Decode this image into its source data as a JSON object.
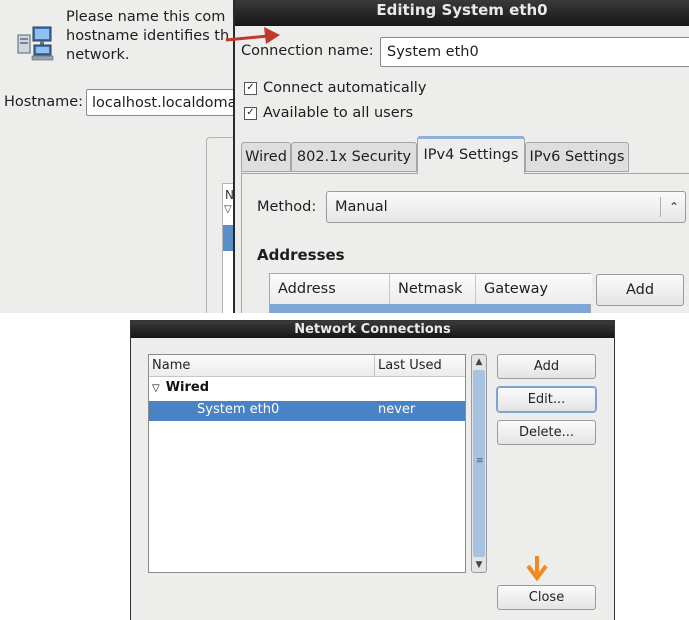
{
  "installer": {
    "message": "Please name this com\nhostname identifies th\nnetwork.",
    "hostname_label": "Hostname:",
    "hostname_value": "localhost.localdomai"
  },
  "edit_dialog": {
    "title": "Editing System eth0",
    "connection_name_label": "Connection name:",
    "connection_name_value": "System eth0",
    "connect_automatically": {
      "label": "Connect automatically",
      "checked": true
    },
    "available_to_all_users": {
      "label": "Available to all users",
      "checked": true
    },
    "tabs": [
      "Wired",
      "802.1x Security",
      "IPv4 Settings",
      "IPv6 Settings"
    ],
    "active_tab": "IPv4 Settings",
    "method_label": "Method:",
    "method_value": "Manual",
    "addresses_heading": "Addresses",
    "address_columns": [
      "Address",
      "Netmask",
      "Gateway"
    ],
    "add_button": "Add"
  },
  "network_connections": {
    "title": "Network Connections",
    "columns": {
      "name": "Name",
      "last_used": "Last Used"
    },
    "group": "Wired",
    "connections": [
      {
        "name": "System eth0",
        "last_used": "never",
        "selected": true
      }
    ],
    "buttons": {
      "add": "Add",
      "edit": "Edit...",
      "delete": "Delete...",
      "close": "Close"
    }
  },
  "colors": {
    "selection": "#4a82c6",
    "annotation_red": "#c0392b",
    "annotation_orange": "#f08a1c"
  }
}
